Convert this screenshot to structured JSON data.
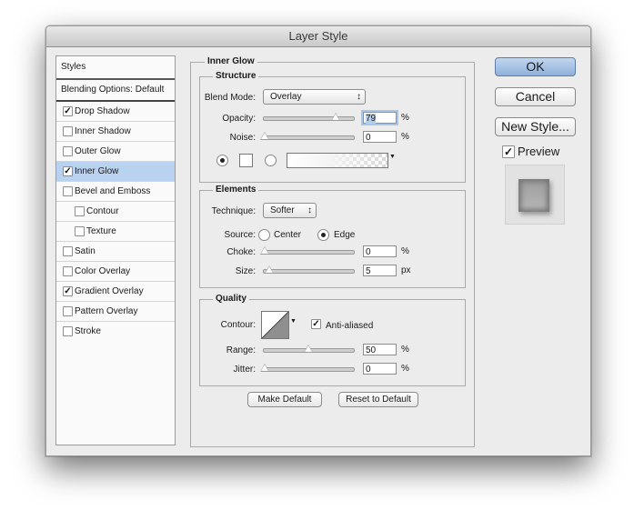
{
  "window": {
    "title": "Layer Style"
  },
  "styles_list": {
    "header": "Styles",
    "blending": "Blending Options: Default",
    "items": [
      {
        "label": "Drop Shadow",
        "checked": true
      },
      {
        "label": "Inner Shadow",
        "checked": false
      },
      {
        "label": "Outer Glow",
        "checked": false
      },
      {
        "label": "Inner Glow",
        "checked": true,
        "selected": true
      },
      {
        "label": "Bevel and Emboss",
        "checked": false
      },
      {
        "label": "Contour",
        "checked": false,
        "indent": true
      },
      {
        "label": "Texture",
        "checked": false,
        "indent": true
      },
      {
        "label": "Satin",
        "checked": false
      },
      {
        "label": "Color Overlay",
        "checked": false
      },
      {
        "label": "Gradient Overlay",
        "checked": true
      },
      {
        "label": "Pattern Overlay",
        "checked": false
      },
      {
        "label": "Stroke",
        "checked": false
      }
    ]
  },
  "panel": {
    "title": "Inner Glow",
    "structure": {
      "legend": "Structure",
      "blend_mode_label": "Blend Mode:",
      "blend_mode": "Overlay",
      "opacity_label": "Opacity:",
      "opacity": "79",
      "noise_label": "Noise:",
      "noise": "0",
      "unit": "%"
    },
    "elements": {
      "legend": "Elements",
      "technique_label": "Technique:",
      "technique": "Softer",
      "source_label": "Source:",
      "center": "Center",
      "edge": "Edge",
      "choke_label": "Choke:",
      "choke": "0",
      "size_label": "Size:",
      "size": "5",
      "pct": "%",
      "px": "px"
    },
    "quality": {
      "legend": "Quality",
      "contour_label": "Contour:",
      "anti_aliased": "Anti-aliased",
      "range_label": "Range:",
      "range": "50",
      "jitter_label": "Jitter:",
      "jitter": "0",
      "unit": "%"
    },
    "make_default": "Make Default",
    "reset_default": "Reset to Default"
  },
  "buttons": {
    "ok": "OK",
    "cancel": "Cancel",
    "new_style": "New Style...",
    "preview": "Preview"
  },
  "colors": {
    "selection": "#b9d2ef",
    "ok_button": "#9bbbe2"
  }
}
